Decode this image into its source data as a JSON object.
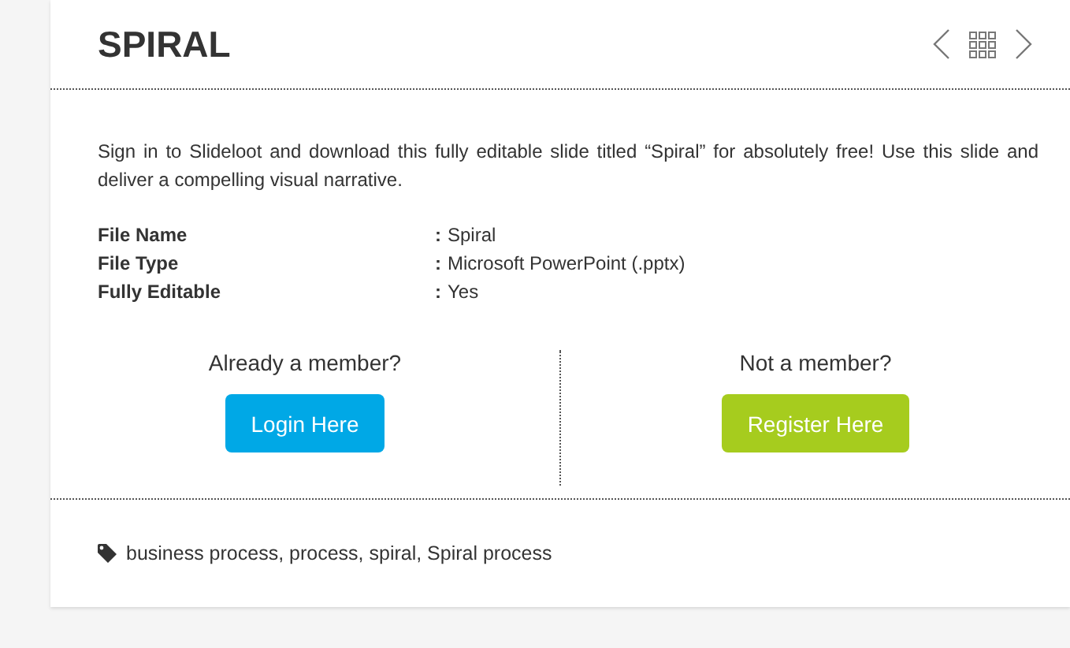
{
  "title": "SPIRAL",
  "description": "Sign in to Slideloot and download this fully editable slide titled “Spiral” for absolutely free! Use this slide and deliver a compelling visual narrative.",
  "details": [
    {
      "label": "File Name",
      "separator": ":",
      "value": "Spiral"
    },
    {
      "label": "File Type",
      "separator": ":",
      "value": "Microsoft PowerPoint (.pptx)"
    },
    {
      "label": "Fully Editable",
      "separator": ":",
      "value": "Yes"
    }
  ],
  "members": [
    {
      "question": "Already a member?",
      "button": "Login Here",
      "kind": "login"
    },
    {
      "question": "Not a member?",
      "button": "Register Here",
      "kind": "register"
    }
  ],
  "tags": "business process, process, spiral, Spiral process"
}
